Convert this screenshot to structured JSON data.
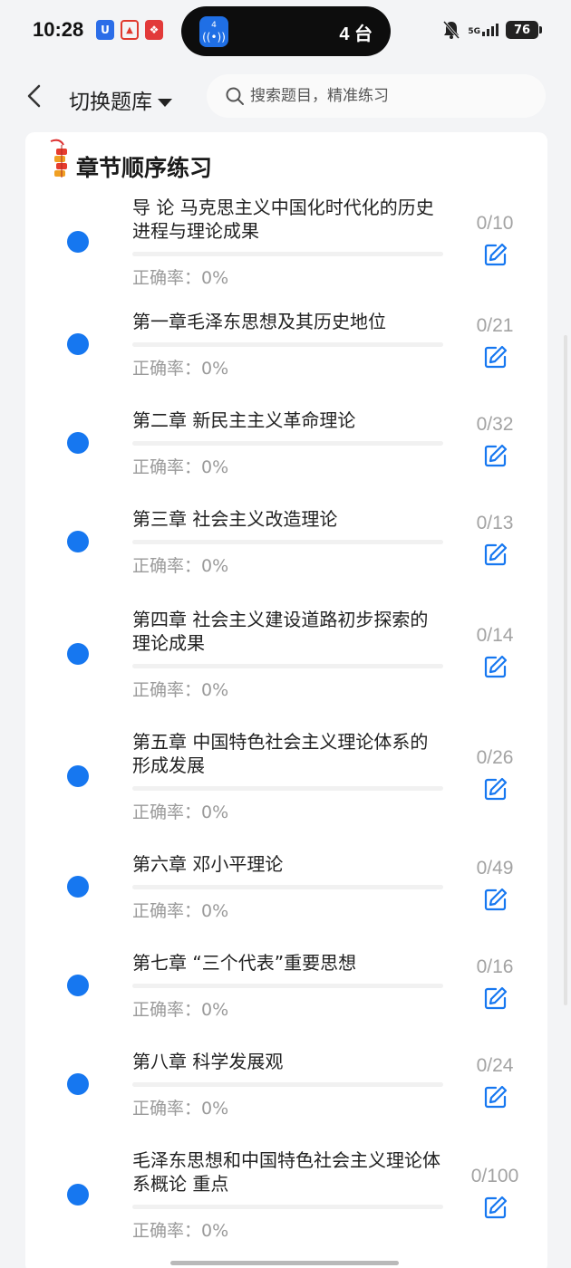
{
  "status_bar": {
    "time": "10:28",
    "island_badge": "4",
    "island_text": "4 台",
    "network": "5G",
    "battery": "76"
  },
  "header": {
    "back_icon": "chevron-left-icon",
    "switch_label": "切换题库",
    "search_placeholder": "搜索题目，精准练习"
  },
  "section": {
    "title": "章节顺序练习",
    "icon": "firecracker-icon"
  },
  "accuracy_label": "正确率：0%",
  "chapters": [
    {
      "title": "导 论 马克思主义中国化时代化的历史进程与理论成果",
      "progress": "0/10",
      "done": 0
    },
    {
      "title": "第一章毛泽东思想及其历史地位",
      "progress": "0/21",
      "done": 0
    },
    {
      "title": "第二章 新民主主义革命理论",
      "progress": "0/32",
      "done": 0
    },
    {
      "title": "第三章 社会主义改造理论",
      "progress": "0/13",
      "done": 0
    },
    {
      "title": "第四章 社会主义建设道路初步探索的理论成果",
      "progress": "0/14",
      "done": 0
    },
    {
      "title": "第五章 中国特色社会主义理论体系的形成发展",
      "progress": "0/26",
      "done": 0
    },
    {
      "title": "第六章 邓小平理论",
      "progress": "0/49",
      "done": 0
    },
    {
      "title": "第七章 “三个代表”重要思想",
      "progress": "0/16",
      "done": 0
    },
    {
      "title": "第八章 科学发展观",
      "progress": "0/24",
      "done": 0
    },
    {
      "title": "毛泽东思想和中国特色社会主义理论体系概论 重点",
      "progress": "0/100",
      "done": 0
    }
  ],
  "colors": {
    "accent": "#1677f0",
    "muted_text": "#9a9a9a"
  }
}
